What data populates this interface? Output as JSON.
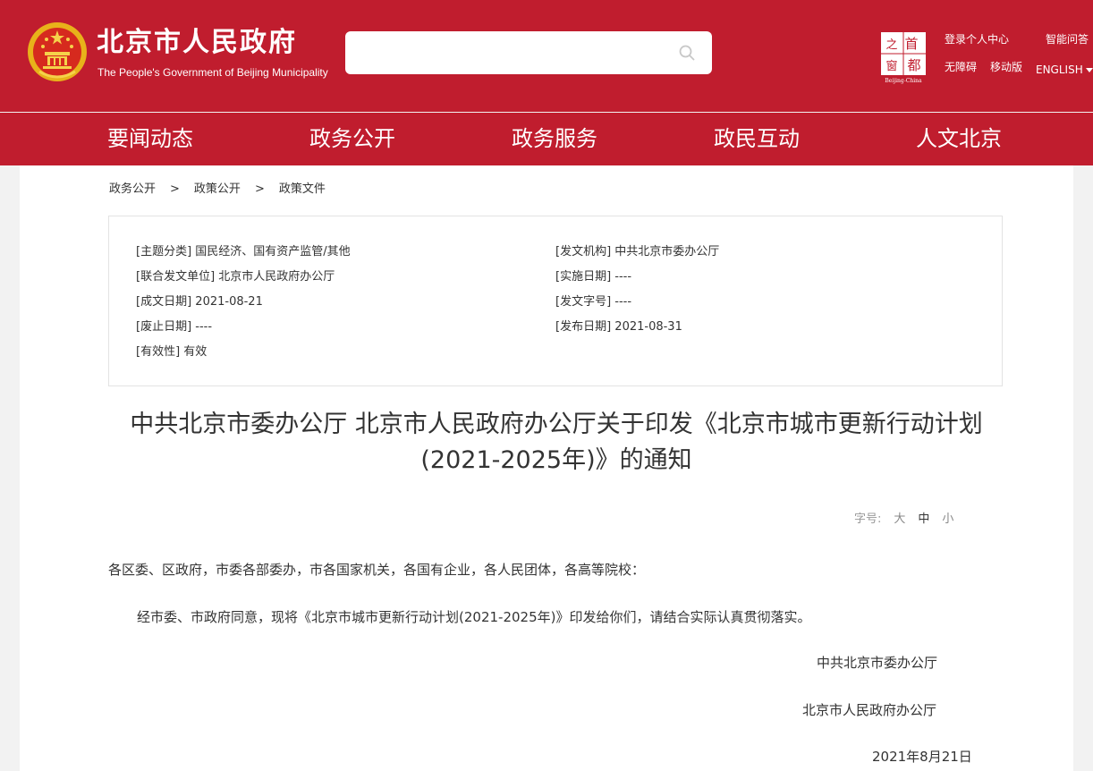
{
  "header": {
    "title": "北京市人民政府",
    "subtitle": "The People's Government of Beijing Municipality",
    "search_placeholder": "",
    "capital_logo_text": [
      "首",
      "都",
      "之",
      "窗",
      "Beijing-China"
    ],
    "links": {
      "login": "登录个人中心",
      "smart_qa": "智能问答",
      "accessible": "无障碍",
      "mobile": "移动版",
      "english": "ENGLISH"
    },
    "colors": {
      "brand_red": "#c01d2e",
      "white": "#ffffff"
    }
  },
  "nav": {
    "items": [
      "要闻动态",
      "政务公开",
      "政务服务",
      "政民互动",
      "人文北京"
    ]
  },
  "breadcrumb": {
    "items": [
      "政务公开",
      "政策公开",
      "政策文件"
    ],
    "separator": ">"
  },
  "meta": {
    "left": [
      {
        "key": "[主题分类]",
        "value": "国民经济、国有资产监管/其他"
      },
      {
        "key": "[联合发文单位]",
        "value": "北京市人民政府办公厅"
      },
      {
        "key": "[成文日期]",
        "value": "2021-08-21"
      },
      {
        "key": "[废止日期]",
        "value": "----"
      },
      {
        "key": "[有效性]",
        "value": "有效"
      }
    ],
    "right": [
      {
        "key": "[发文机构]",
        "value": "中共北京市委办公厅"
      },
      {
        "key": "[实施日期]",
        "value": "----"
      },
      {
        "key": "[发文字号]",
        "value": "----"
      },
      {
        "key": "[发布日期]",
        "value": "2021-08-31"
      }
    ]
  },
  "document": {
    "title_line1": "中共北京市委办公厅 北京市人民政府办公厅关于印发《北京市城市更新行动计划",
    "title_line2": "(2021-2025年)》的通知",
    "font_size_label": "字号:",
    "font_size_options": [
      "大",
      "中",
      "小"
    ],
    "salutation": "各区委、区政府，市委各部委办，市各国家机关，各国有企业，各人民团体，各高等院校：",
    "body": "经市委、市政府同意，现将《北京市城市更新行动计划(2021-2025年)》印发给你们，请结合实际认真贯彻落实。",
    "signatory1": "中共北京市委办公厅",
    "signatory2": "北京市人民政府办公厅",
    "date": "2021年8月21日"
  }
}
